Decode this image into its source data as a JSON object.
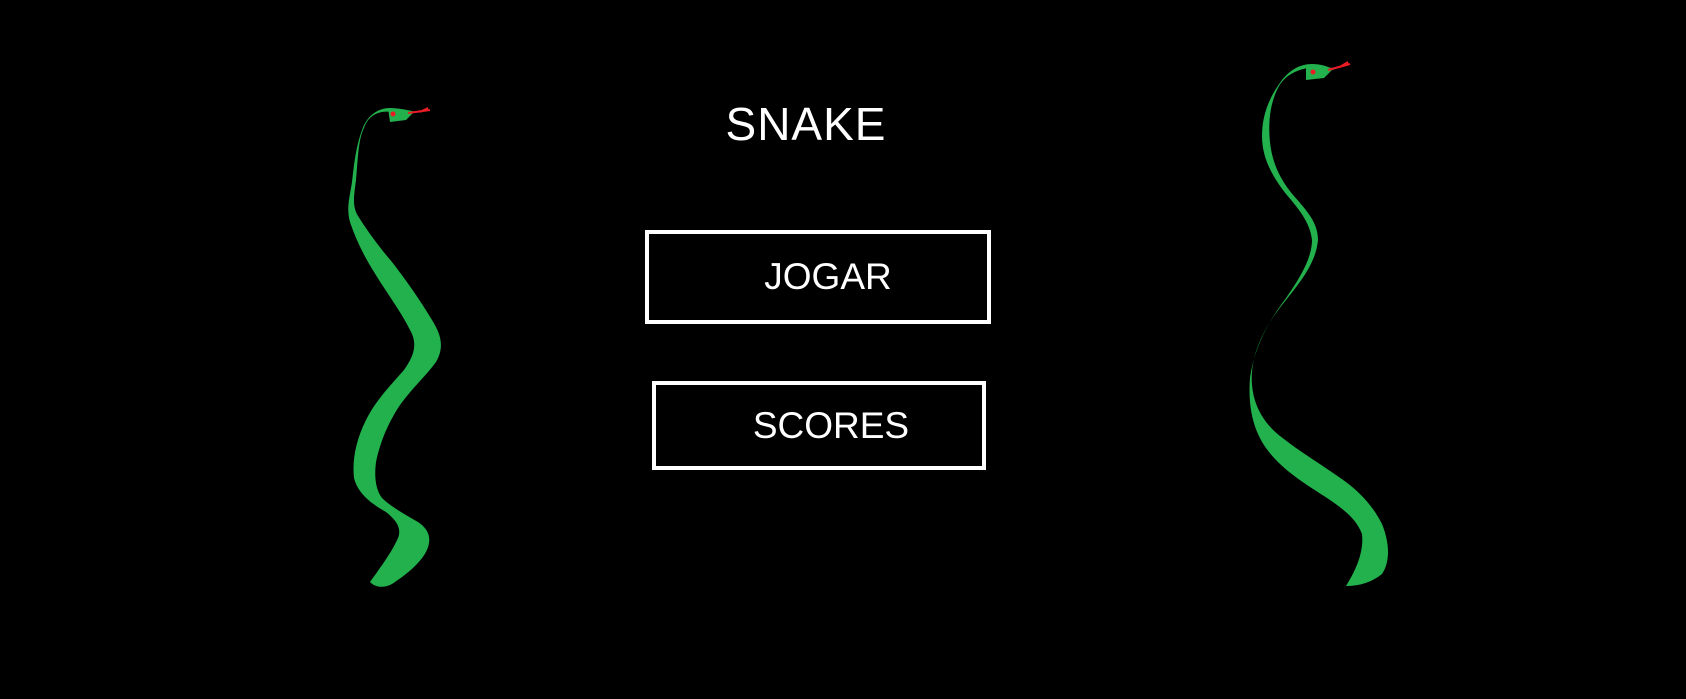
{
  "menu": {
    "title": "SNAKE",
    "play_label": "JOGAR",
    "scores_label": "SCORES"
  },
  "colors": {
    "background": "#000000",
    "text": "#ffffff",
    "snake_body": "#22b14c",
    "snake_tongue": "#ed1c24"
  },
  "decorations": {
    "left_snake": "snake-icon",
    "right_snake": "snake-icon"
  }
}
